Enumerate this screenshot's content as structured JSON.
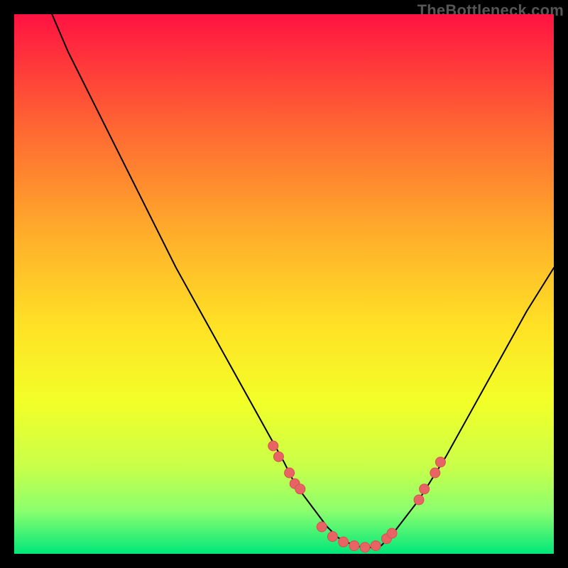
{
  "watermark": "TheBottleneck.com",
  "colors": {
    "gradient_top": "#FF1342",
    "gradient_mid1": "#FF6A32",
    "gradient_mid2": "#FFB22A",
    "gradient_mid3": "#FFE225",
    "gradient_mid4": "#F2FF28",
    "gradient_mid5": "#C8FF4A",
    "gradient_mid6": "#8CFF6E",
    "gradient_bottom": "#00E77A",
    "curve": "#000000",
    "marker_fill": "#E86464",
    "marker_stroke": "#D65050"
  },
  "chart_data": {
    "type": "line",
    "title": "",
    "xlabel": "",
    "ylabel": "",
    "xlim": [
      0,
      100
    ],
    "ylim": [
      0,
      100
    ],
    "grid": false,
    "legend": false,
    "series": [
      {
        "name": "bottleneck-curve",
        "x": [
          7,
          10,
          15,
          20,
          25,
          30,
          35,
          40,
          45,
          50,
          52,
          55,
          58,
          60,
          62,
          65,
          68,
          70,
          75,
          80,
          85,
          90,
          95,
          100
        ],
        "y": [
          100,
          93,
          83,
          73,
          63,
          53,
          44,
          35,
          26,
          17,
          13,
          9,
          5,
          3,
          2,
          1,
          1.5,
          3.5,
          10,
          18,
          27,
          36,
          45,
          53
        ]
      }
    ],
    "markers": [
      {
        "x": 48,
        "y": 20
      },
      {
        "x": 49,
        "y": 18
      },
      {
        "x": 51,
        "y": 15
      },
      {
        "x": 52,
        "y": 13
      },
      {
        "x": 53,
        "y": 12
      },
      {
        "x": 57,
        "y": 5
      },
      {
        "x": 59,
        "y": 3.2
      },
      {
        "x": 61,
        "y": 2.2
      },
      {
        "x": 63,
        "y": 1.5
      },
      {
        "x": 65,
        "y": 1.2
      },
      {
        "x": 67,
        "y": 1.5
      },
      {
        "x": 69,
        "y": 2.8
      },
      {
        "x": 70,
        "y": 3.8
      },
      {
        "x": 75,
        "y": 10
      },
      {
        "x": 76,
        "y": 12
      },
      {
        "x": 78,
        "y": 15
      },
      {
        "x": 79,
        "y": 17
      }
    ]
  }
}
